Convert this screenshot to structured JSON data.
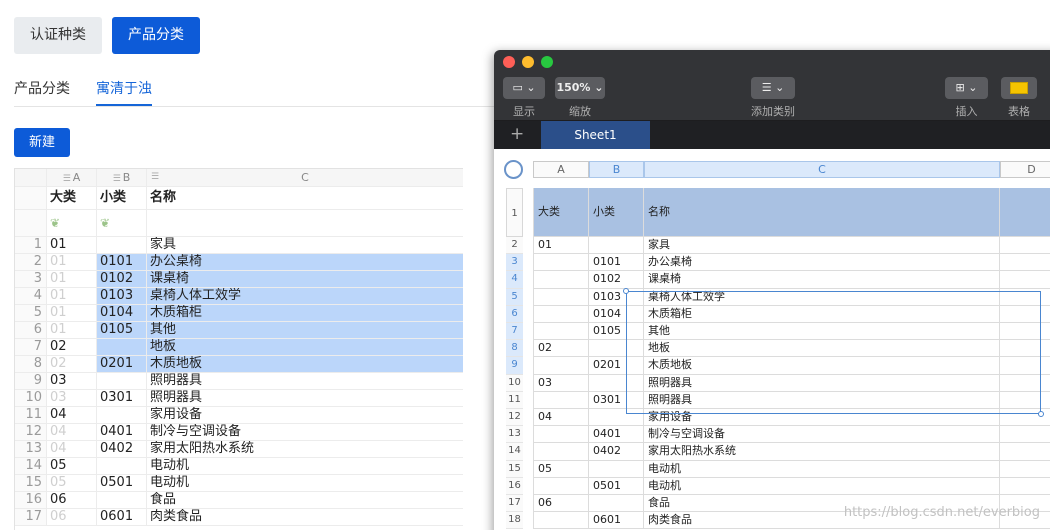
{
  "app": {
    "top_buttons": {
      "cert": "认证种类",
      "product": "产品分类"
    },
    "sub_tabs": [
      "产品分类",
      "寓清于浊"
    ],
    "new_button": "新建"
  },
  "left_sheet": {
    "columns": [
      "A",
      "B",
      "C"
    ],
    "header": {
      "a": "大类",
      "b": "小类",
      "c": "名称"
    },
    "rows": [
      {
        "n": "1",
        "a": "01",
        "b": "",
        "c": "家具",
        "sel": false
      },
      {
        "n": "2",
        "a": "01",
        "b": "0101",
        "c": "办公桌椅",
        "sel": true
      },
      {
        "n": "3",
        "a": "01",
        "b": "0102",
        "c": "课桌椅",
        "sel": true
      },
      {
        "n": "4",
        "a": "01",
        "b": "0103",
        "c": "桌椅人体工效学",
        "sel": true
      },
      {
        "n": "5",
        "a": "01",
        "b": "0104",
        "c": "木质箱柜",
        "sel": true
      },
      {
        "n": "6",
        "a": "01",
        "b": "0105",
        "c": "其他",
        "sel": true
      },
      {
        "n": "7",
        "a": "02",
        "b": "",
        "c": "地板",
        "sel": true
      },
      {
        "n": "8",
        "a": "02",
        "b": "0201",
        "c": "木质地板",
        "sel": true
      },
      {
        "n": "9",
        "a": "03",
        "b": "",
        "c": "照明器具",
        "sel": false
      },
      {
        "n": "10",
        "a": "03",
        "b": "0301",
        "c": "照明器具",
        "sel": false
      },
      {
        "n": "11",
        "a": "04",
        "b": "",
        "c": "家用设备",
        "sel": false
      },
      {
        "n": "12",
        "a": "04",
        "b": "0401",
        "c": "制冷与空调设备",
        "sel": false
      },
      {
        "n": "13",
        "a": "04",
        "b": "0402",
        "c": "家用太阳热水系统",
        "sel": false
      },
      {
        "n": "14",
        "a": "05",
        "b": "",
        "c": "电动机",
        "sel": false
      },
      {
        "n": "15",
        "a": "05",
        "b": "0501",
        "c": "电动机",
        "sel": false
      },
      {
        "n": "16",
        "a": "06",
        "b": "",
        "c": "食品",
        "sel": false
      },
      {
        "n": "17",
        "a": "06",
        "b": "0601",
        "c": "肉类食品",
        "sel": false
      }
    ]
  },
  "numbers_window": {
    "toolbar": {
      "view_label": "显示",
      "zoom_value": "150%",
      "zoom_label": "缩放",
      "category_label": "添加类别",
      "insert_label": "插入",
      "table_label": "表格"
    },
    "sheet_tab": "Sheet1",
    "columns": [
      "A",
      "B",
      "C",
      "D"
    ],
    "header": {
      "a": "大类",
      "b": "小类",
      "c": "名称"
    },
    "rows": [
      {
        "n": "2",
        "a": "01",
        "b": "",
        "c": "家具"
      },
      {
        "n": "3",
        "a": "",
        "b": "0101",
        "c": "办公桌椅"
      },
      {
        "n": "4",
        "a": "",
        "b": "0102",
        "c": "课桌椅"
      },
      {
        "n": "5",
        "a": "",
        "b": "0103",
        "c": "桌椅人体工效学"
      },
      {
        "n": "6",
        "a": "",
        "b": "0104",
        "c": "木质箱柜"
      },
      {
        "n": "7",
        "a": "",
        "b": "0105",
        "c": "其他"
      },
      {
        "n": "8",
        "a": "02",
        "b": "",
        "c": "地板"
      },
      {
        "n": "9",
        "a": "",
        "b": "0201",
        "c": "木质地板"
      },
      {
        "n": "10",
        "a": "03",
        "b": "",
        "c": "照明器具"
      },
      {
        "n": "11",
        "a": "",
        "b": "0301",
        "c": "照明器具"
      },
      {
        "n": "12",
        "a": "04",
        "b": "",
        "c": "家用设备"
      },
      {
        "n": "13",
        "a": "",
        "b": "0401",
        "c": "制冷与空调设备"
      },
      {
        "n": "14",
        "a": "",
        "b": "0402",
        "c": "家用太阳热水系统"
      },
      {
        "n": "15",
        "a": "05",
        "b": "",
        "c": "电动机"
      },
      {
        "n": "16",
        "a": "",
        "b": "0501",
        "c": "电动机"
      },
      {
        "n": "17",
        "a": "06",
        "b": "",
        "c": "食品"
      },
      {
        "n": "18",
        "a": "",
        "b": "0601",
        "c": "肉类食品"
      }
    ]
  },
  "watermark": "https://blog.csdn.net/everbiog"
}
